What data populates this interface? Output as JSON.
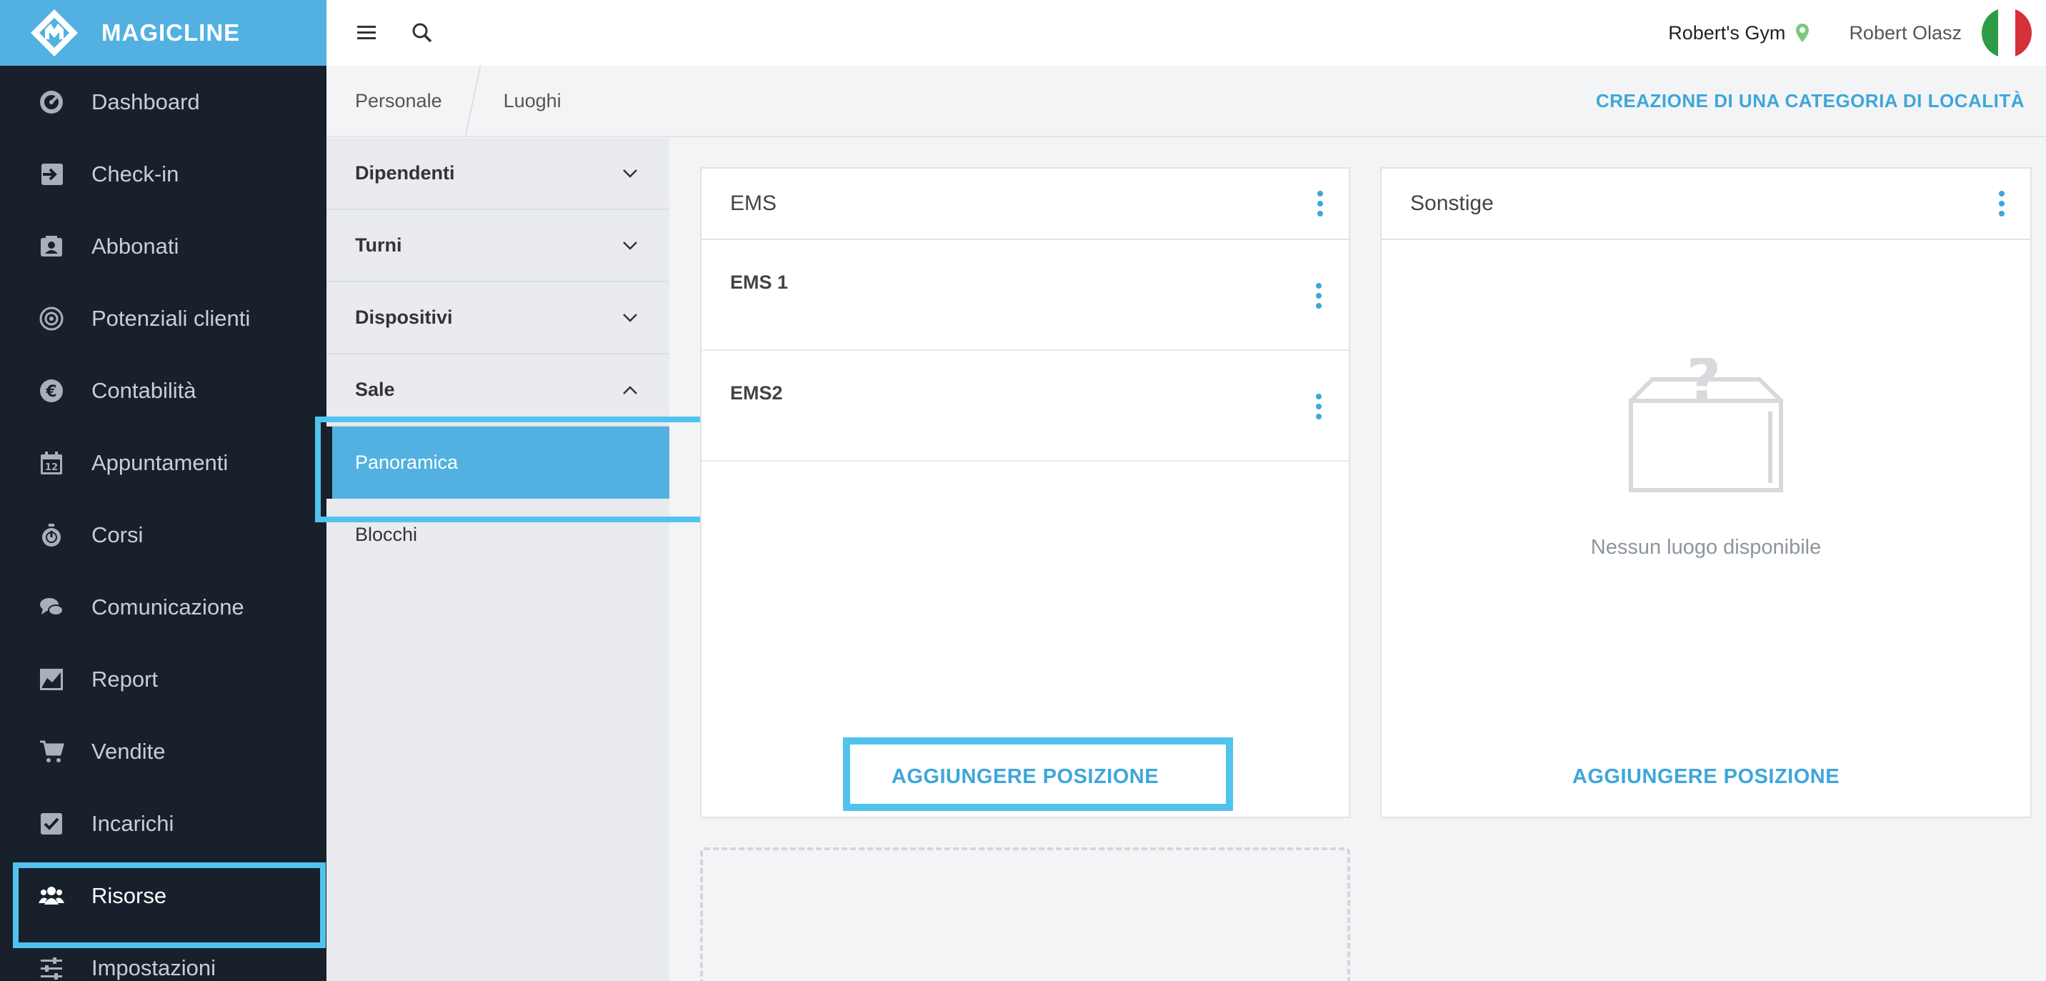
{
  "app": {
    "brand": "MAGICLINE"
  },
  "sidebar": {
    "items": [
      {
        "label": "Dashboard",
        "icon": "dashboard-icon"
      },
      {
        "label": "Check-in",
        "icon": "check-in-icon"
      },
      {
        "label": "Abbonati",
        "icon": "member-card-icon"
      },
      {
        "label": "Potenziali clienti",
        "icon": "target-icon"
      },
      {
        "label": "Contabilità",
        "icon": "euro-icon"
      },
      {
        "label": "Appuntamenti",
        "icon": "calendar-icon"
      },
      {
        "label": "Corsi",
        "icon": "stopwatch-icon"
      },
      {
        "label": "Comunicazione",
        "icon": "chat-icon"
      },
      {
        "label": "Report",
        "icon": "chart-icon"
      },
      {
        "label": "Vendite",
        "icon": "cart-icon"
      },
      {
        "label": "Incarichi",
        "icon": "checkbox-icon"
      },
      {
        "label": "Risorse",
        "icon": "people-icon",
        "active": true
      },
      {
        "label": "Impostazioni",
        "icon": "sliders-icon"
      }
    ]
  },
  "topbar": {
    "gym": "Robert's Gym",
    "user": "Robert Olasz",
    "flag_colors": [
      "#2e9b47",
      "#ffffff",
      "#d6303a"
    ]
  },
  "breadcrumb": {
    "items": [
      "Personale",
      "Luoghi"
    ],
    "action": "CREAZIONE DI UNA CATEGORIA DI LOCALITÀ"
  },
  "subnav": {
    "sections": [
      {
        "label": "Dipendenti",
        "expanded": false
      },
      {
        "label": "Turni",
        "expanded": false
      },
      {
        "label": "Dispositivi",
        "expanded": false
      },
      {
        "label": "Sale",
        "expanded": true
      }
    ],
    "children": [
      {
        "label": "Panoramica",
        "active": true
      },
      {
        "label": "Blocchi",
        "active": false
      }
    ]
  },
  "panels": {
    "ems": {
      "title": "EMS",
      "locations": [
        "EMS 1",
        "EMS2"
      ],
      "add_label": "AGGIUNGERE POSIZIONE"
    },
    "sonstige": {
      "title": "Sonstige",
      "empty_text": "Nessun luogo disponibile",
      "add_label": "AGGIUNGERE POSIZIONE"
    }
  },
  "colors": {
    "accent": "#52b1e0",
    "link": "#3ea6da",
    "sidebar_bg": "#18212b",
    "highlight": "#52c3ec"
  }
}
